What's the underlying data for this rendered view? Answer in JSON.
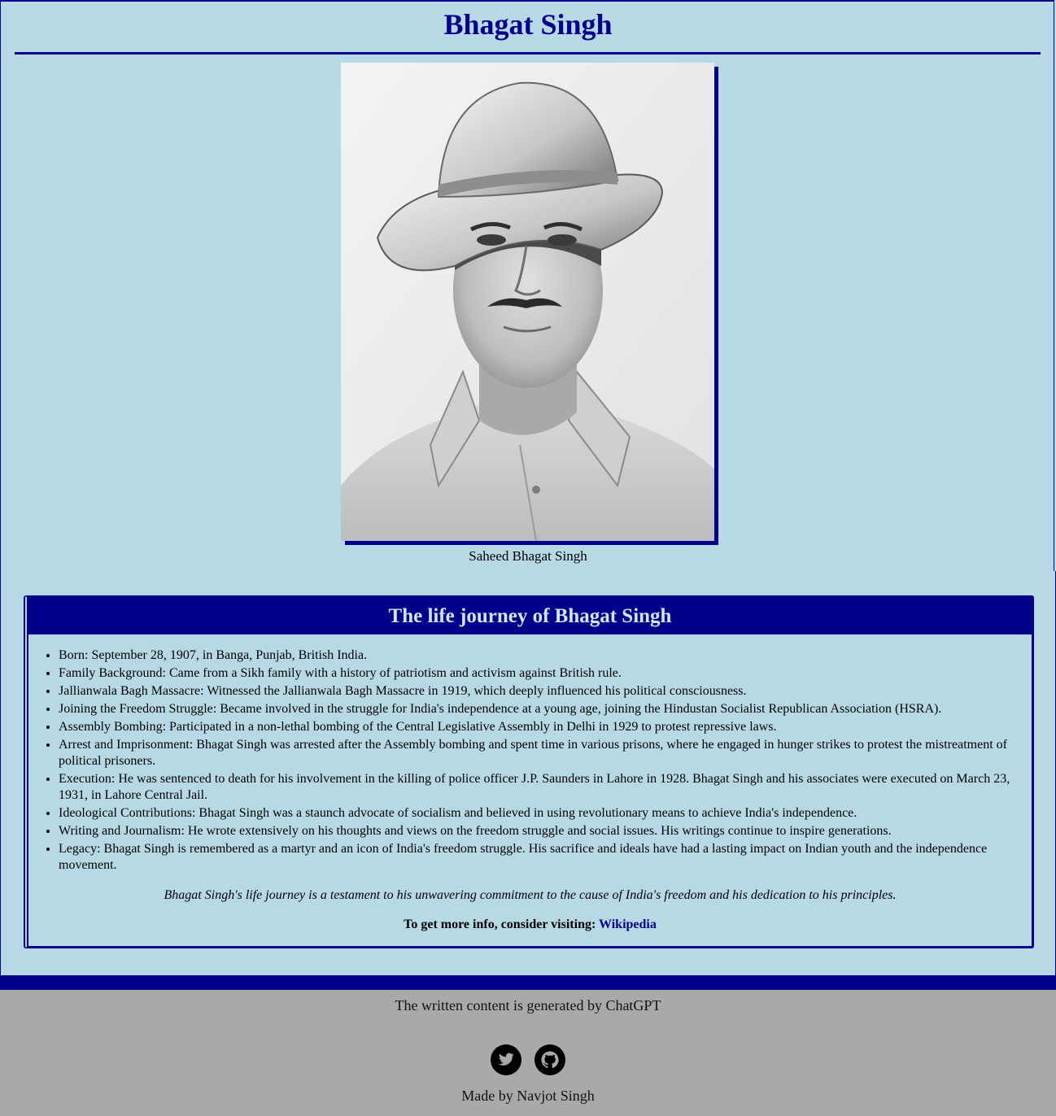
{
  "header": {
    "title": "Bhagat Singh"
  },
  "photo": {
    "alt": "Saheed Bhagat Singh portrait",
    "caption": "Saheed Bhagat Singh"
  },
  "journey": {
    "heading": "The life journey of Bhagat Singh",
    "items": [
      "Born: September 28, 1907, in Banga, Punjab, British India.",
      "Family Background: Came from a Sikh family with a history of patriotism and activism against British rule.",
      "Jallianwala Bagh Massacre: Witnessed the Jallianwala Bagh Massacre in 1919, which deeply influenced his political consciousness.",
      "Joining the Freedom Struggle: Became involved in the struggle for India's independence at a young age, joining the Hindustan Socialist Republican Association (HSRA).",
      "Assembly Bombing: Participated in a non-lethal bombing of the Central Legislative Assembly in Delhi in 1929 to protest repressive laws.",
      "Arrest and Imprisonment: Bhagat Singh was arrested after the Assembly bombing and spent time in various prisons, where he engaged in hunger strikes to protest the mistreatment of political prisoners.",
      "Execution: He was sentenced to death for his involvement in the killing of police officer J.P. Saunders in Lahore in 1928. Bhagat Singh and his associates were executed on March 23, 1931, in Lahore Central Jail.",
      "Ideological Contributions: Bhagat Singh was a staunch advocate of socialism and believed in using revolutionary means to achieve India's independence.",
      "Writing and Journalism: He wrote extensively on his thoughts and views on the freedom struggle and social issues. His writings continue to inspire generations.",
      "Legacy: Bhagat Singh is remembered as a martyr and an icon of India's freedom struggle. His sacrifice and ideals have had a lasting impact on Indian youth and the independence movement."
    ],
    "closing": "Bhagat Singh's life journey is a testament to his unwavering commitment to the cause of India's freedom and his dedication to his principles.",
    "more_info_prefix": "To get more info, consider visiting:",
    "more_info_link": "Wikipedia"
  },
  "footer": {
    "credit": "The written content is generated by ChatGPT",
    "icons": [
      "twitter-icon",
      "github-icon"
    ],
    "maker": "Made by Navjot Singh"
  },
  "colors": {
    "background": "#b7d9e5",
    "accent": "#00008b",
    "footer_background": "#a9a9a9"
  }
}
